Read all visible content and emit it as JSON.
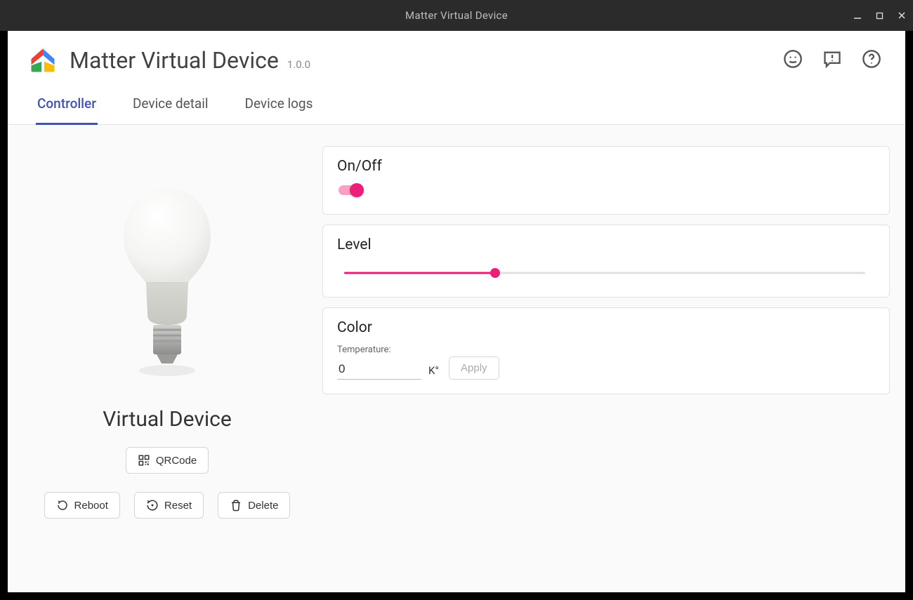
{
  "window": {
    "title": "Matter Virtual Device"
  },
  "app": {
    "title": "Matter Virtual Device",
    "version": "1.0.0"
  },
  "tabs": {
    "controller": "Controller",
    "device_detail": "Device detail",
    "device_logs": "Device logs",
    "active": "controller"
  },
  "device": {
    "name": "Virtual Device",
    "buttons": {
      "qrcode": "QRCode",
      "reboot": "Reboot",
      "reset": "Reset",
      "delete": "Delete"
    }
  },
  "cards": {
    "onoff": {
      "title": "On/Off",
      "value": true
    },
    "level": {
      "title": "Level",
      "value_percent": 29
    },
    "color": {
      "title": "Color",
      "temperature_label": "Temperature:",
      "temperature_value": "0",
      "temperature_unit": "K°",
      "apply_label": "Apply"
    }
  },
  "colors": {
    "accent": "#ec1e79",
    "tab_active": "#3f51b5"
  }
}
